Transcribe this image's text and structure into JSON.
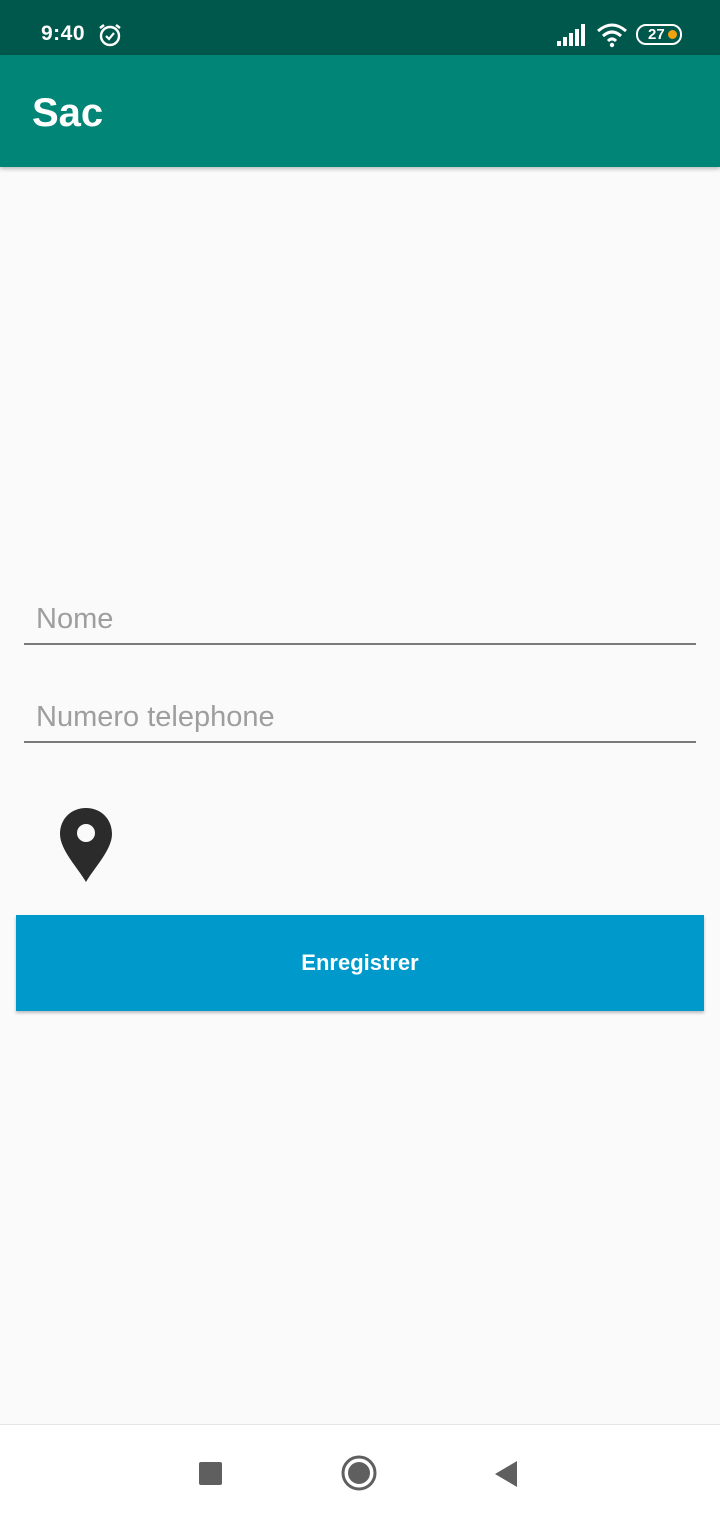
{
  "status_bar": {
    "time": "9:40",
    "battery_level": "27",
    "icons": [
      "alarm-icon",
      "signal-icon",
      "wifi-icon",
      "battery-icon"
    ]
  },
  "app_bar": {
    "title": "Sac"
  },
  "form": {
    "name_field": {
      "placeholder": "Nome",
      "value": ""
    },
    "phone_field": {
      "placeholder": "Numero telephone",
      "value": ""
    },
    "location_icon": "map-pin-icon",
    "save_label": "Enregistrer"
  },
  "nav_bar": {
    "icons": [
      "recent-apps-icon",
      "home-icon",
      "back-icon"
    ]
  },
  "colors": {
    "status_bar": "#00574b",
    "app_bar": "#008577",
    "button": "#0099cc",
    "background": "#fafafa"
  }
}
